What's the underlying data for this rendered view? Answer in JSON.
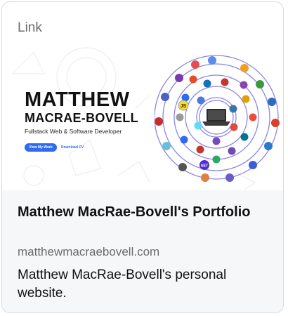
{
  "card": {
    "label": "Link",
    "title": "Matthew MacRae-Bovell's Portfolio",
    "domain": "matthewmacraebovell.com",
    "description": "Matthew MacRae-Bovell's personal website."
  },
  "preview": {
    "name_line1": "MATTHEW",
    "name_line2": "MACRAE-BOVELL",
    "subtitle": "Fullstack Web & Software Developer",
    "primary_button": "View My Work",
    "secondary_link": "Download CV",
    "icon_badges": [
      "JS",
      "NET"
    ],
    "colors": {
      "accent": "#2f6bef",
      "orbit_ring": "#8c86e8",
      "footer_bg": "#f6f7f9"
    }
  }
}
